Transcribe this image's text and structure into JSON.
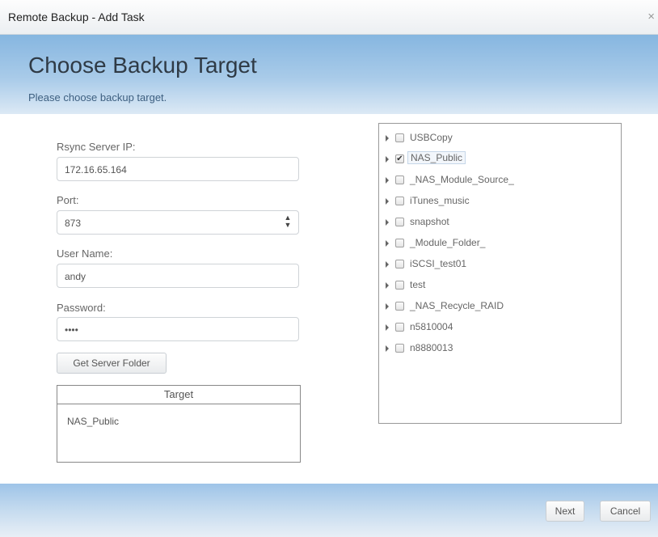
{
  "window": {
    "title": "Remote Backup - Add Task",
    "close_label": "×"
  },
  "header": {
    "title": "Choose Backup Target",
    "subtitle": "Please choose backup target."
  },
  "form": {
    "ip_label": "Rsync Server IP:",
    "ip_value": "172.16.65.164",
    "port_label": "Port:",
    "port_value": "873",
    "user_label": "User Name:",
    "user_value": "andy",
    "password_label": "Password:",
    "password_value": "••••",
    "get_folder_button": "Get Server Folder"
  },
  "target_table": {
    "header": "Target",
    "value": "NAS_Public"
  },
  "tree": {
    "items": [
      {
        "label": "USBCopy",
        "checked": false
      },
      {
        "label": "NAS_Public",
        "checked": true
      },
      {
        "label": "_NAS_Module_Source_",
        "checked": false
      },
      {
        "label": "iTunes_music",
        "checked": false
      },
      {
        "label": "snapshot",
        "checked": false
      },
      {
        "label": "_Module_Folder_",
        "checked": false
      },
      {
        "label": "iSCSI_test01",
        "checked": false
      },
      {
        "label": "test",
        "checked": false
      },
      {
        "label": "_NAS_Recycle_RAID",
        "checked": false
      },
      {
        "label": "n5810004",
        "checked": false
      },
      {
        "label": "n8880013",
        "checked": false
      }
    ]
  },
  "footer": {
    "next_button": "Next",
    "cancel_button": "Cancel"
  },
  "icons": {
    "check": "✔",
    "spin_up": "▲",
    "spin_down": "▼"
  },
  "colors": {
    "header_blue": "#86b6e0",
    "footer_blue": "#9ec4e8"
  }
}
